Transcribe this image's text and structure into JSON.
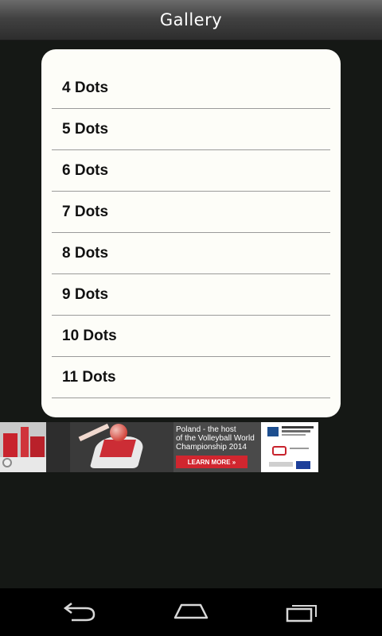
{
  "header": {
    "title": "Gallery"
  },
  "list": {
    "items": [
      {
        "label": "4 Dots"
      },
      {
        "label": "5 Dots"
      },
      {
        "label": "6 Dots"
      },
      {
        "label": "7 Dots"
      },
      {
        "label": "8 Dots"
      },
      {
        "label": "9 Dots"
      },
      {
        "label": "10 Dots"
      },
      {
        "label": "11 Dots"
      }
    ]
  },
  "ad": {
    "line1": "Poland - the host",
    "line2": "of the Volleyball World",
    "line3": "Championship 2014",
    "cta": "LEARN MORE »"
  },
  "nav": {
    "back_icon": "back-arrow-icon",
    "home_icon": "home-icon",
    "recent_icon": "recent-apps-icon"
  },
  "colors": {
    "background": "#151815",
    "card": "#fdfdf8",
    "divider": "#9a9a9a",
    "ad_cta": "#d1262f"
  }
}
